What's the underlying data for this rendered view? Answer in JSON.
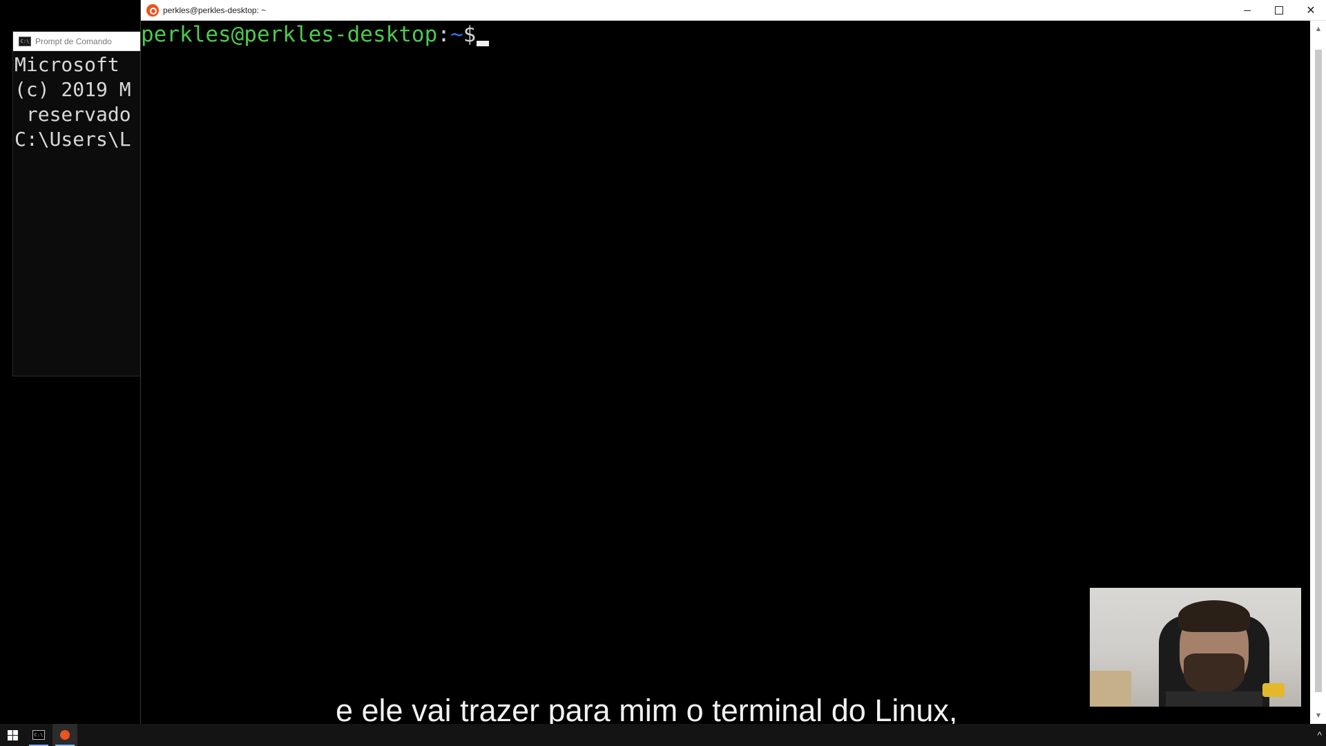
{
  "cmd_window": {
    "title": "Prompt de Comando",
    "lines": [
      "Microsoft",
      "(c) 2019 M",
      " reservado",
      "",
      "C:\\Users\\L"
    ]
  },
  "terminal": {
    "title": "perkles@perkles-desktop: ~",
    "prompt": {
      "user_host": "perkles@perkles-desktop",
      "colon": ":",
      "path": "~",
      "dollar": "$"
    }
  },
  "window_controls": {
    "minimize": "minimize-icon",
    "maximize": "maximize-icon",
    "close": "close-icon",
    "close_glyph": "✕"
  },
  "scrollbar": {
    "up_glyph": "▲",
    "down_glyph": "▼"
  },
  "subtitle": "e ele vai trazer para mim o terminal do Linux,",
  "taskbar": {
    "start_icon": "windows-start-icon",
    "cmd_icon_text": "C:\\",
    "tray_chevron": "^"
  },
  "colors": {
    "prompt_user": "#4ec94e",
    "prompt_path": "#3b6fe0",
    "ubuntu_orange": "#e95420",
    "terminal_bg": "#000000"
  }
}
